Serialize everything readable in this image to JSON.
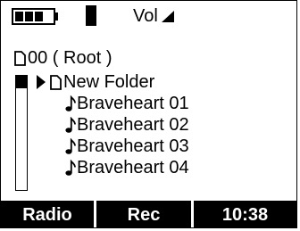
{
  "status": {
    "battery_level": 0.75,
    "volume_label": "Vol"
  },
  "path": {
    "label": "00  ( Root )"
  },
  "list": {
    "scroll_position": 0,
    "items": [
      {
        "label": "New Folder",
        "type": "folder",
        "icon": "folder-icon",
        "selected": true
      },
      {
        "label": "Braveheart 01",
        "type": "audio",
        "icon": "music-note-icon"
      },
      {
        "label": "Braveheart 02",
        "type": "audio",
        "icon": "music-note-icon"
      },
      {
        "label": "Braveheart 03",
        "type": "audio",
        "icon": "music-note-icon"
      },
      {
        "label": "Braveheart 04",
        "type": "audio",
        "icon": "music-note-icon"
      }
    ]
  },
  "tabs": {
    "radio": "Radio",
    "rec": "Rec",
    "time": "10:38"
  },
  "colors": {
    "foreground": "#000000",
    "background": "#ffffff"
  }
}
